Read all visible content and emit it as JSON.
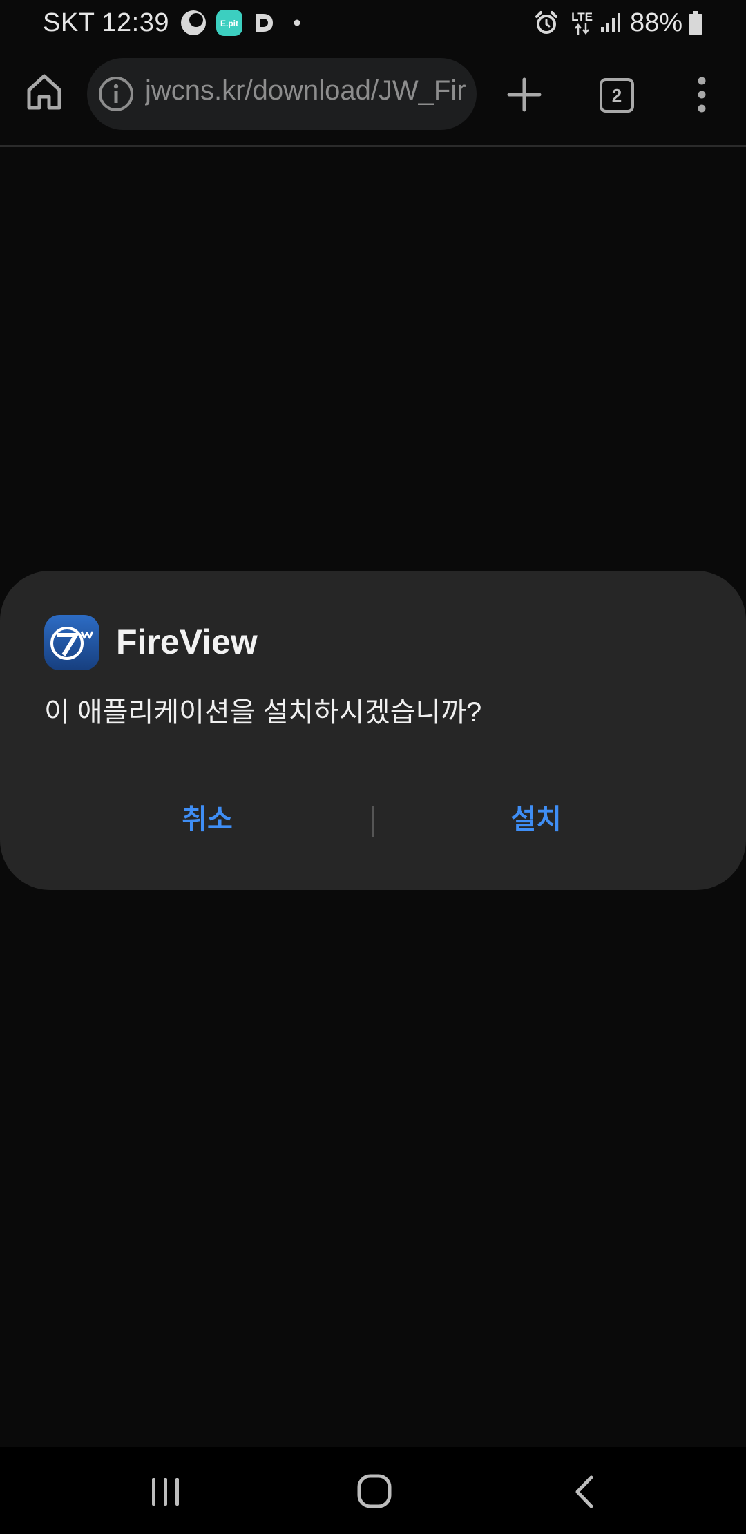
{
  "status_bar": {
    "carrier": "SKT",
    "time": "12:39",
    "notification_icons": [
      "moon-icon",
      "epit-app-icon",
      "d-app-icon",
      "more-dot-icon"
    ],
    "epit_label": "E.pit",
    "d_label": "D",
    "network": "LTE",
    "battery": "88%"
  },
  "browser": {
    "url": "jwcns.kr/download/JW_FireView.apk",
    "tab_count": "2"
  },
  "dialog": {
    "app_name": "FireView",
    "message": "이 애플리케이션을 설치하시겠습니까?",
    "cancel_label": "취소",
    "install_label": "설치"
  },
  "colors": {
    "accent": "#3f8ef5",
    "dialog_bg": "#262626",
    "page_bg": "#0a0a0a"
  }
}
